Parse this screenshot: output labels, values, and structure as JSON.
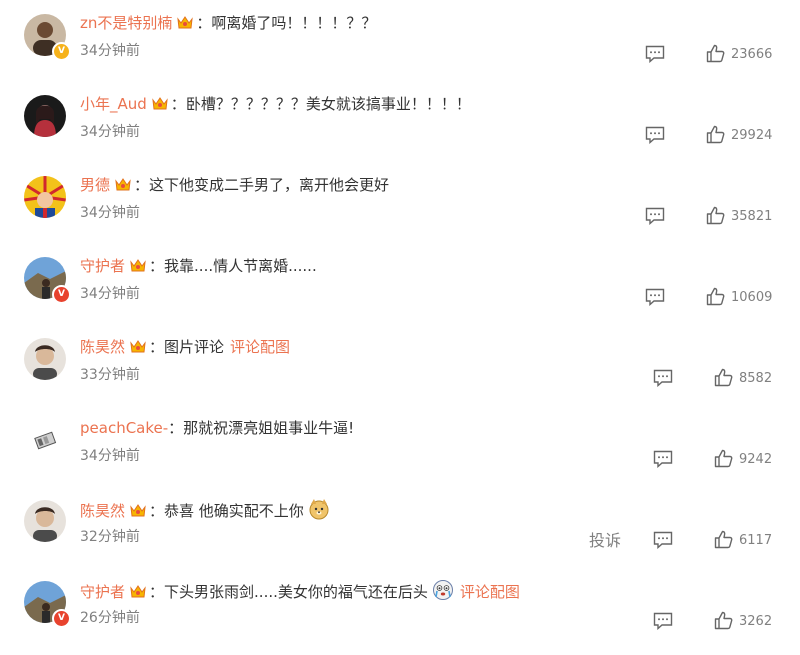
{
  "comments": [
    {
      "user": "zn不是特别楠",
      "text": "啊离婚了吗！！！！？？",
      "time": "34分钟前",
      "likes": "23666",
      "verified": "gold"
    },
    {
      "user": "小年_Aud",
      "text": "卧槽？？？？？？美女就该搞事业！！！！",
      "time": "34分钟前",
      "likes": "29924",
      "verified": ""
    },
    {
      "user": "男德",
      "text": "这下他变成二手男了，离开他会更好",
      "time": "34分钟前",
      "likes": "35821",
      "verified": ""
    },
    {
      "user": "守护者",
      "text": "我靠....情人节离婚......",
      "time": "34分钟前",
      "likes": "10609",
      "verified": "red"
    },
    {
      "user": "陈昊然",
      "text": "图片评论",
      "pic_link": "评论配图",
      "time": "33分钟前",
      "likes": "8582",
      "verified": ""
    },
    {
      "user": "peachCake-",
      "text": "那就祝漂亮姐姐事业牛逼!",
      "time": "34分钟前",
      "likes": "9242",
      "verified": ""
    },
    {
      "user": "陈昊然",
      "text": "恭喜 他确实配不上你",
      "time": "32分钟前",
      "likes": "6117",
      "verified": "",
      "report": "投诉"
    },
    {
      "user": "守护者",
      "text": "下头男张雨剑.....美女你的福气还在后头",
      "pic_link": "评论配图",
      "time": "26分钟前",
      "likes": "3262",
      "verified": "red"
    }
  ],
  "colon": "：",
  "colors": {
    "username": "#eb7350",
    "meta": "#808080",
    "text": "#333333"
  }
}
